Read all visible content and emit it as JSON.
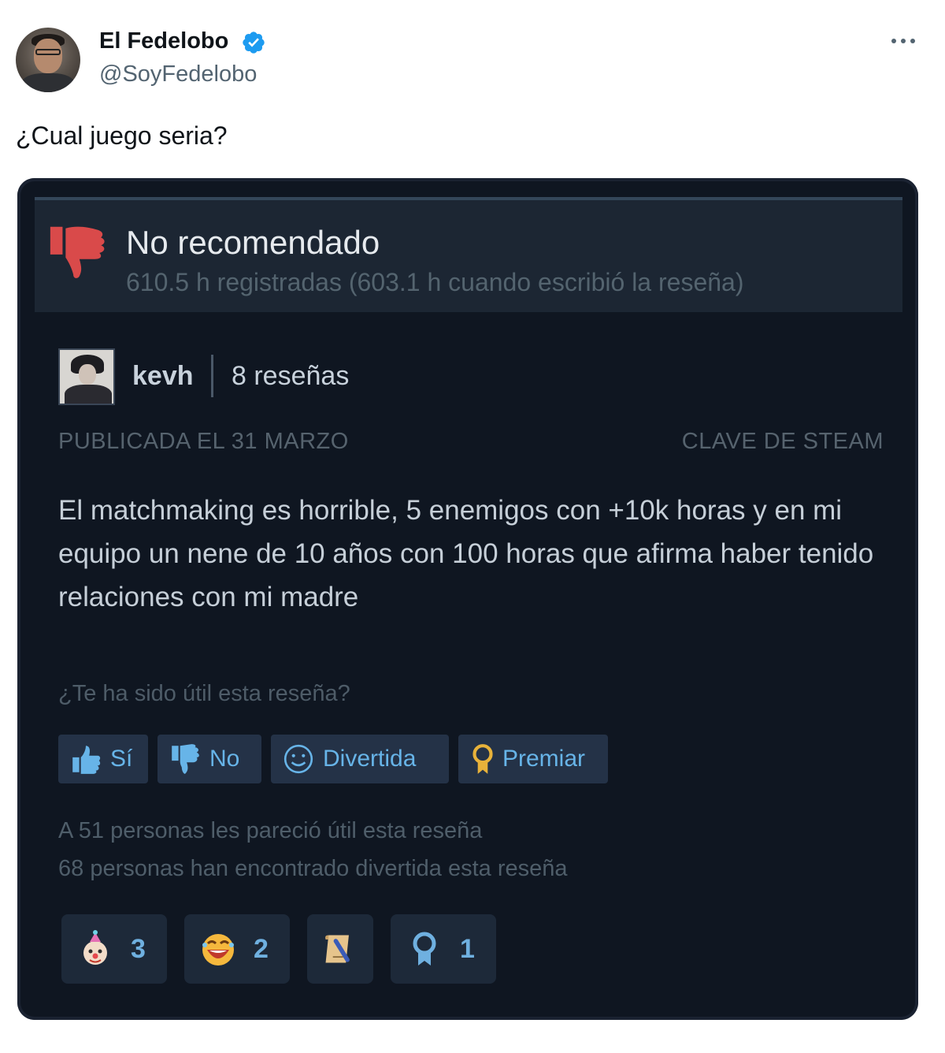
{
  "tweet": {
    "display_name": "El Fedelobo",
    "handle": "@SoyFedelobo",
    "text": "¿Cual juego seria?",
    "verified": true,
    "verified_color": "#1d9bf0"
  },
  "review": {
    "verdict": "No recomendado",
    "hours": "610.5 h registradas (603.1 h cuando escribió la reseña)",
    "author": "kevh",
    "review_count": "8 reseñas",
    "posted": "PUBLICADA EL 31 MARZO",
    "source": "CLAVE DE STEAM",
    "body": "El matchmaking es horrible, 5 enemigos con +10k horas y en mi equipo un nene de 10 años con 100 horas que afirma haber tenido relaciones con mi madre",
    "helpful_question": "¿Te ha sido útil esta reseña?",
    "buttons": {
      "yes": "Sí",
      "no": "No",
      "funny": "Divertida",
      "award": "Premiar"
    },
    "stats": {
      "helpful": "A 51 personas les pareció útil esta reseña",
      "funny": "68 personas han encontrado divertida esta reseña"
    },
    "awards": [
      {
        "icon": "clown-award-icon",
        "count": "3"
      },
      {
        "icon": "laughing-face-award-icon",
        "count": "2"
      },
      {
        "icon": "scroll-award-icon",
        "count": ""
      },
      {
        "icon": "medal-award-icon",
        "count": "1"
      }
    ],
    "colors": {
      "card_bg": "#0f1621",
      "header_bg": "#1c2633",
      "accent_blue": "#67b4e8",
      "thumb_down_red": "#d94a4a"
    }
  }
}
